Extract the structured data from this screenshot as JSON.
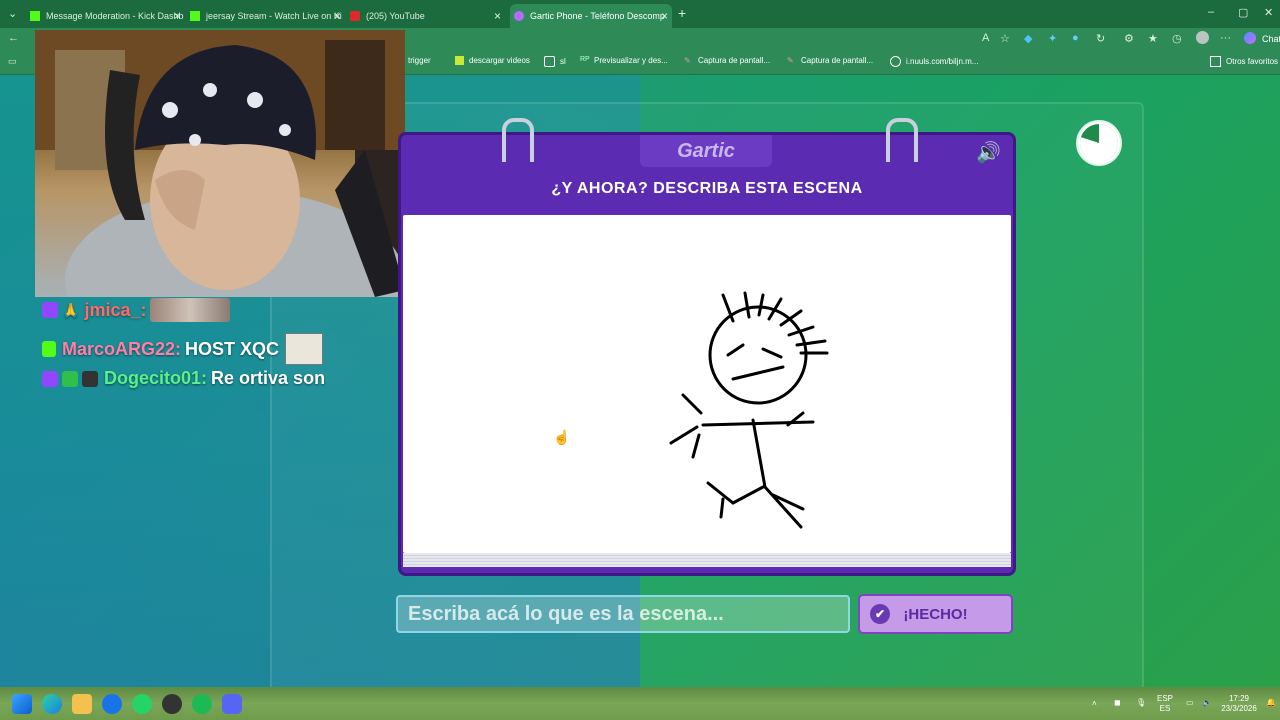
{
  "browser": {
    "tabs": [
      {
        "label": "Message Moderation - Kick Dashb",
        "icon": "kick-icon",
        "active": false
      },
      {
        "label": "jeersay Stream - Watch Live on Ki",
        "icon": "kick-icon",
        "active": false
      },
      {
        "label": "(205) YouTube",
        "icon": "youtube-icon",
        "active": false
      },
      {
        "label": "Gartic Phone - Teléfono Descomp",
        "icon": "gartic-icon",
        "active": true
      }
    ],
    "new_tab": "+",
    "profile_label": "Chat",
    "bookmarks": [
      {
        "label": "trigger"
      },
      {
        "label": "descargar videos"
      },
      {
        "label": "sl"
      },
      {
        "label": "Previsualizar y des..."
      },
      {
        "label": "Captura de pantall..."
      },
      {
        "label": "Captura de pantall..."
      },
      {
        "label": "i.nuuls.com/biljn.m..."
      }
    ],
    "other_favorites": "Otros favoritos"
  },
  "chat": [
    {
      "user": "jmica_:",
      "message": "",
      "user_color": "#ff6a6a"
    },
    {
      "user": "MarcoARG22:",
      "message": "HOST XQC",
      "user_color": "#ff7fa8"
    },
    {
      "user": "Dogecito01:",
      "message": "Re ortiva son",
      "user_color": "#5cf08a"
    }
  ],
  "game": {
    "logo": "Gartic",
    "prompt": "¿Y AHORA? DESCRIBA ESTA ESCENA",
    "answer_placeholder": "Escriba acá lo que es la escena...",
    "done_label": "¡HECHO!",
    "timer_fraction": 0.8
  },
  "taskbar": {
    "lang_top": "ESP",
    "lang_bottom": "ES",
    "time": "17:29",
    "date": "23/3/2026"
  },
  "colors": {
    "card": "#5b2cb1",
    "done_button": "#c59be8",
    "page_green": "#1aa163"
  }
}
